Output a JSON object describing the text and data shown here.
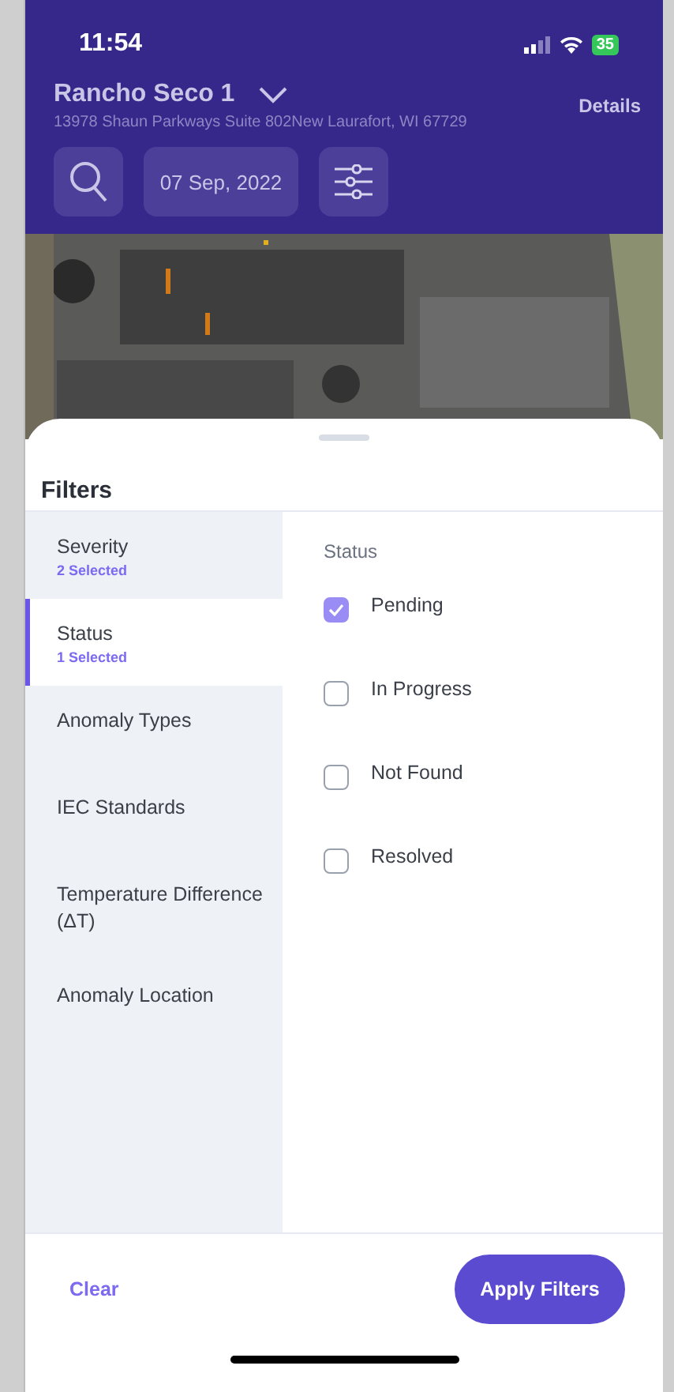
{
  "status_bar": {
    "time": "11:54",
    "battery": "35"
  },
  "header": {
    "site": "Rancho Seco 1",
    "address": "13978 Shaun Parkways Suite 802New Laurafort, WI 67729",
    "details_link": "Details",
    "date": "07 Sep, 2022"
  },
  "filters": {
    "title": "Filters",
    "categories": [
      {
        "label": "Severity",
        "note": "2 Selected",
        "selected": false
      },
      {
        "label": "Status",
        "note": "1 Selected",
        "selected": true
      },
      {
        "label": "Anomaly Types",
        "selected": false
      },
      {
        "label": "IEC Standards",
        "selected": false
      },
      {
        "label": "Temperature Difference (ΔT)",
        "selected": false
      },
      {
        "label": "Anomaly Location",
        "selected": false
      }
    ],
    "section_title": "Status",
    "options": [
      {
        "label": "Pending",
        "checked": true
      },
      {
        "label": "In Progress",
        "checked": false
      },
      {
        "label": "Not Found",
        "checked": false
      },
      {
        "label": "Resolved",
        "checked": false
      }
    ],
    "clear": "Clear",
    "apply": "Apply Filters"
  }
}
